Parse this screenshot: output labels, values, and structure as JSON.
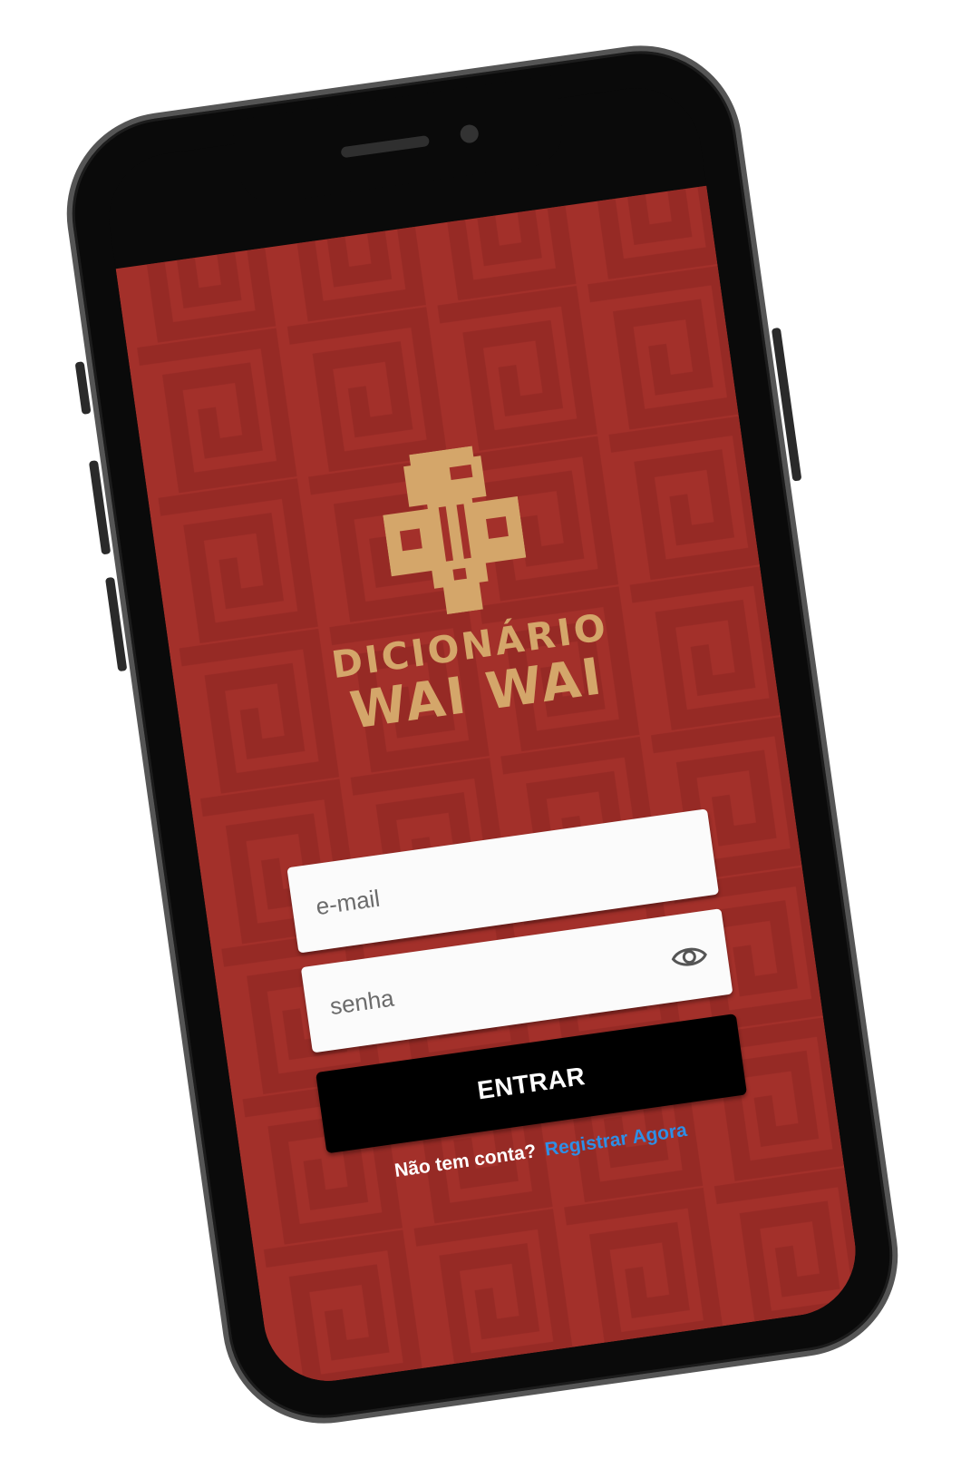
{
  "app": {
    "logo_line1": "DICIONÁRIO",
    "logo_line2": "WAI WAI",
    "background_color": "#a3302a",
    "accent_color": "#d4a66a"
  },
  "login_form": {
    "email_placeholder": "e-mail",
    "password_placeholder": "senha",
    "show_password_icon": "eye-icon",
    "submit_label": "ENTRAR"
  },
  "register": {
    "prompt": "Não tem conta?",
    "link_label": "Registrar Agora",
    "link_color": "#2e8fe6"
  }
}
